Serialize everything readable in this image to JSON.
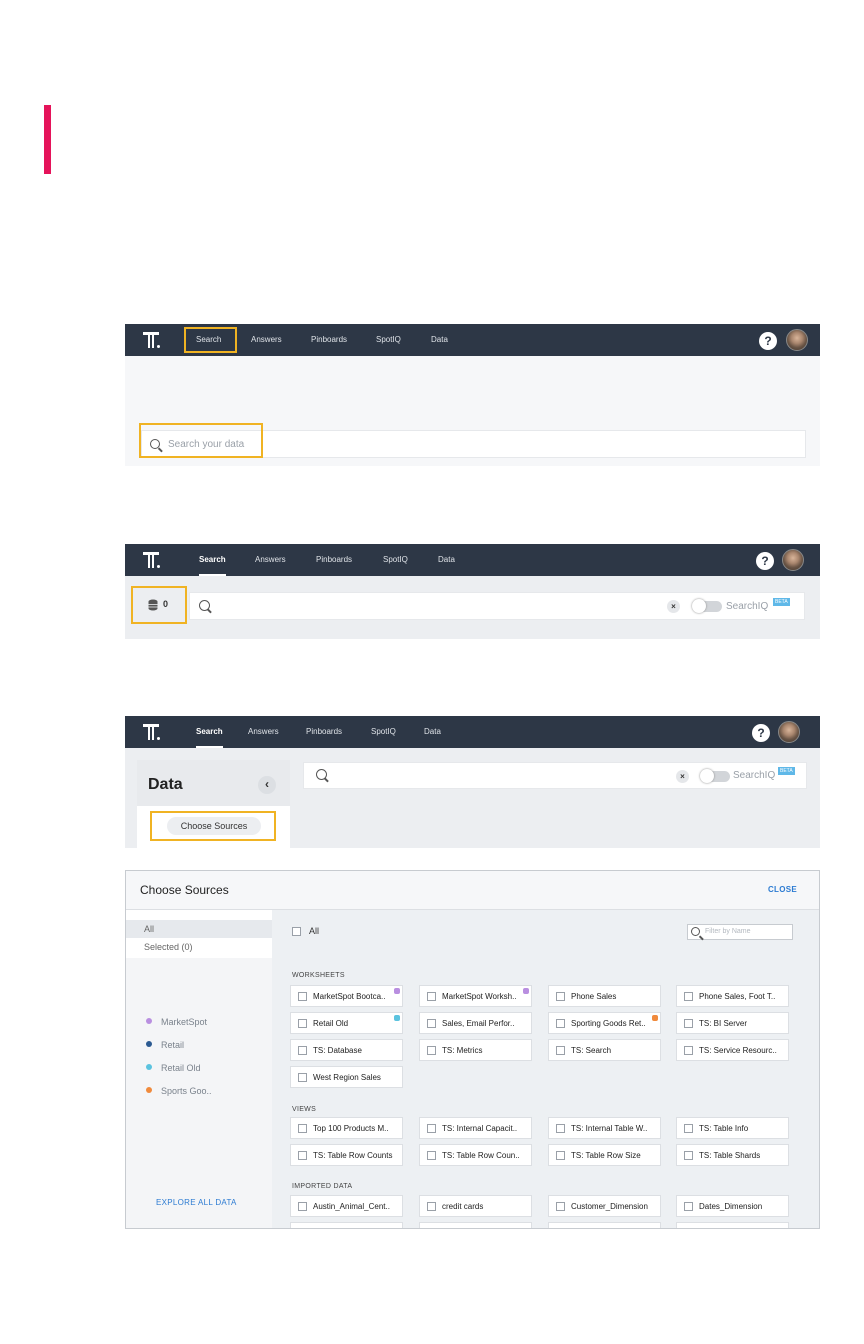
{
  "panel1": {
    "nav": {
      "items": [
        "Search",
        "Answers",
        "Pinboards",
        "SpotIQ",
        "Data"
      ],
      "help": "?"
    },
    "search_placeholder": "Search your data"
  },
  "panel2": {
    "nav": {
      "items": [
        "Search",
        "Answers",
        "Pinboards",
        "SpotIQ",
        "Data"
      ],
      "help": "?"
    },
    "sources_count": "0",
    "clear": "×",
    "searchiq_label": "SearchIQ",
    "beta": "BETA"
  },
  "panel3": {
    "nav": {
      "items": [
        "Search",
        "Answers",
        "Pinboards",
        "SpotIQ",
        "Data"
      ],
      "help": "?"
    },
    "sidebar_title": "Data",
    "collapse": "‹",
    "choose_sources_button": "Choose Sources",
    "clear": "×",
    "searchiq_label": "SearchIQ",
    "beta": "BETA"
  },
  "modal": {
    "title": "Choose Sources",
    "close": "CLOSE",
    "filters": [
      "All",
      "Selected (0)"
    ],
    "all_checkbox": "All",
    "filter_placeholder": "Filter by Name",
    "legend": [
      {
        "label": "MarketSpot",
        "color": "#b98fe0"
      },
      {
        "label": "Retail",
        "color": "#2b5a91"
      },
      {
        "label": "Retail Old",
        "color": "#5bc3df"
      },
      {
        "label": "Sports Goo..",
        "color": "#f08a3c"
      }
    ],
    "explore_link": "EXPLORE ALL DATA",
    "sections": {
      "worksheets": "WORKSHEETS",
      "views": "VIEWS",
      "imported": "IMPORTED DATA"
    },
    "worksheets": [
      {
        "label": "MarketSpot Bootca..",
        "tag": "#b98fe0"
      },
      {
        "label": "MarketSpot Worksh..",
        "tag": "#b98fe0"
      },
      {
        "label": "Phone Sales",
        "tag": ""
      },
      {
        "label": "Phone Sales, Foot T..",
        "tag": ""
      },
      {
        "label": "Retail Old",
        "tag": "#5bc3df"
      },
      {
        "label": "Sales, Email Perfor..",
        "tag": ""
      },
      {
        "label": "Sporting Goods Ret..",
        "tag": "#f08a3c"
      },
      {
        "label": "TS: BI Server",
        "tag": ""
      },
      {
        "label": "TS: Database",
        "tag": ""
      },
      {
        "label": "TS: Metrics",
        "tag": ""
      },
      {
        "label": "TS: Search",
        "tag": ""
      },
      {
        "label": "TS: Service Resourc..",
        "tag": ""
      },
      {
        "label": "West Region Sales",
        "tag": ""
      }
    ],
    "views": [
      {
        "label": "Top 100 Products M..",
        "tag": ""
      },
      {
        "label": "TS: Internal Capacit..",
        "tag": ""
      },
      {
        "label": "TS: Internal Table W..",
        "tag": ""
      },
      {
        "label": "TS: Table Info",
        "tag": ""
      },
      {
        "label": "TS: Table Row Counts",
        "tag": ""
      },
      {
        "label": "TS: Table Row Coun..",
        "tag": ""
      },
      {
        "label": "TS: Table Row Size",
        "tag": ""
      },
      {
        "label": "TS: Table Shards",
        "tag": ""
      }
    ],
    "imported": [
      {
        "label": "Austin_Animal_Cent..",
        "tag": ""
      },
      {
        "label": "credit cards",
        "tag": ""
      },
      {
        "label": "Customer_Dimension",
        "tag": ""
      },
      {
        "label": "Dates_Dimension",
        "tag": ""
      }
    ]
  }
}
